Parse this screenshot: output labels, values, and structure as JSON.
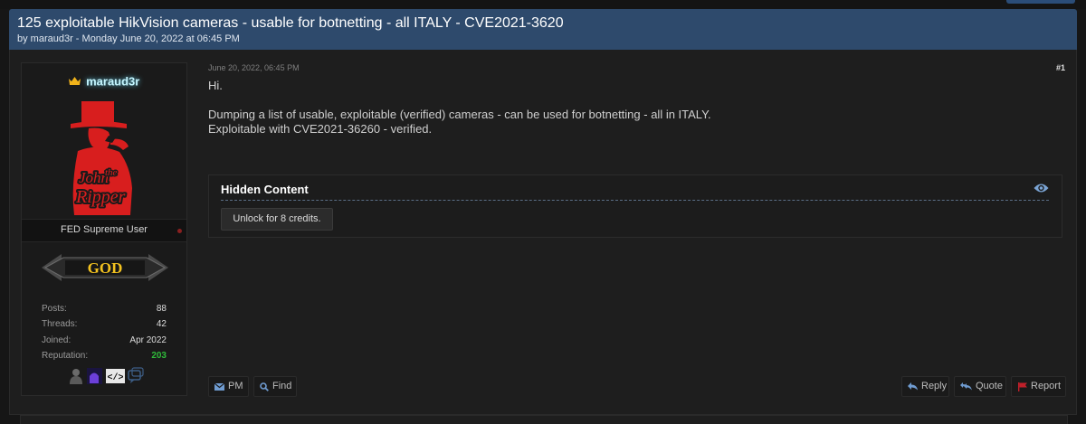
{
  "thread": {
    "title": "125 exploitable HikVision cameras - usable for botnetting - all ITALY - CVE2021-3620",
    "meta": "by maraud3r - Monday June 20, 2022 at 06:45 PM"
  },
  "author": {
    "name": "maraud3r",
    "avatar_text": [
      "John",
      "the",
      "Ripper"
    ],
    "usertitle": "FED Supreme User",
    "rank": "GOD",
    "stats": [
      {
        "label": "Posts:",
        "value": "88"
      },
      {
        "label": "Threads:",
        "value": "42"
      },
      {
        "label": "Joined:",
        "value": "Apr 2022"
      },
      {
        "label": "Reputation:",
        "value": "203"
      }
    ]
  },
  "post": {
    "date": "June 20, 2022, 06:45 PM",
    "number": "#1",
    "greeting": "Hi.",
    "body_line1": "Dumping a list of usable, exploitable (verified) cameras - can be used for botnetting - all in ITALY.",
    "body_line2": "Exploitable with CVE2021-36260 - verified."
  },
  "hidden": {
    "title": "Hidden Content",
    "unlock_label": "Unlock for 8 credits."
  },
  "actions": {
    "pm": "PM",
    "find": "Find",
    "reply": "Reply",
    "quote": "Quote",
    "report": "Report"
  },
  "colors": {
    "header_bg": "#2e4a6c",
    "username_glow": "#c5f6ff",
    "reputation": "#2fb93a",
    "avatar_red": "#d81e1e",
    "report_red": "#c0202a"
  }
}
